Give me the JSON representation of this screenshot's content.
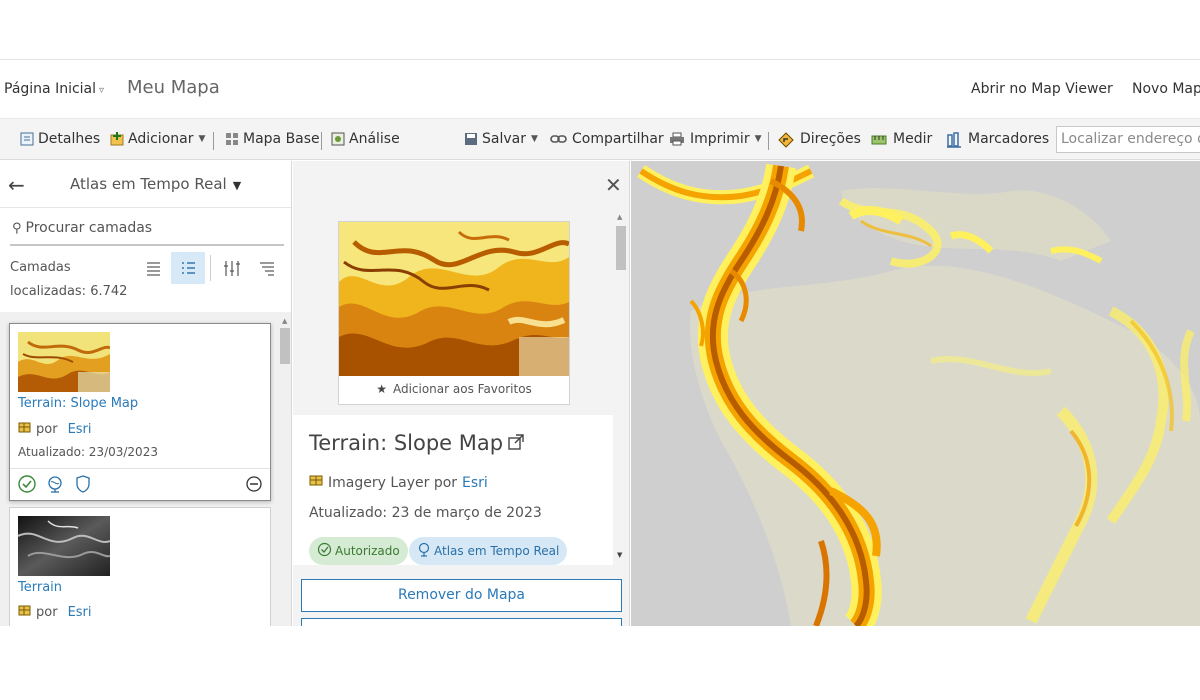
{
  "header": {
    "home_label": "Página Inicial",
    "map_title": "Meu Mapa",
    "open_viewer": "Abrir no Map Viewer",
    "new_map": "Novo Mapa"
  },
  "toolbar": {
    "details": "Detalhes",
    "add": "Adicionar",
    "basemap": "Mapa Base",
    "analysis": "Análise",
    "save": "Salvar",
    "share": "Compartilhar",
    "print": "Imprimir",
    "directions": "Direções",
    "measure": "Medir",
    "bookmarks": "Marcadores",
    "search_placeholder": "Localizar endereço ou lugar"
  },
  "layers_panel": {
    "title": "Atlas em Tempo Real",
    "search_placeholder": "Procurar camadas",
    "count_label": "Camadas",
    "count_value": "localizadas: 6.742",
    "items": [
      {
        "name": "Terrain: Slope Map",
        "by_label": "por",
        "owner": "Esri",
        "updated": "Atualizado: 23/03/2023"
      },
      {
        "name": "Terrain",
        "by_label": "por",
        "owner": "Esri"
      }
    ]
  },
  "detail_panel": {
    "favorite_label": "Adicionar aos Favoritos",
    "title": "Terrain: Slope Map",
    "type_label": "Imagery Layer por",
    "owner": "Esri",
    "updated": "Atualizado: 23 de março de 2023",
    "pill_authorized": "Autorizado",
    "pill_atlas": "Atlas em Tempo Real",
    "remove_button": "Remover do Mapa"
  },
  "colors": {
    "link": "#2a7ab8",
    "toolbar_bg": "#f4f4f4",
    "map_bg": "#cfcfcf",
    "slope_high": "#b85c00",
    "slope_mid": "#f5a300",
    "slope_low": "#fff36a"
  }
}
